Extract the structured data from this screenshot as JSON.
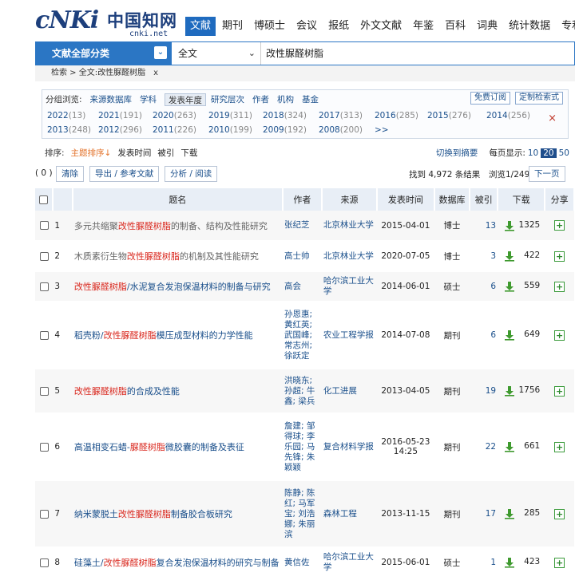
{
  "logo": {
    "brand": "cNKi",
    "cn_name": "中国知网",
    "url": "cnki.net"
  },
  "nav": [
    "文献",
    "期刊",
    "博硕士",
    "会议",
    "报纸",
    "外文文献",
    "年鉴",
    "百科",
    "词典",
    "统计数据",
    "专利"
  ],
  "search": {
    "category": "文献全部分类",
    "field": "全文",
    "query": "改性脲醛树脂"
  },
  "breadcrumb": {
    "text": "检索 > 全文:改性脲醛树脂",
    "close": "x"
  },
  "group": {
    "label": "分组浏览:",
    "tabs": [
      "来源数据库",
      "学科",
      "发表年度",
      "研究层次",
      "作者",
      "机构",
      "基金"
    ],
    "active_tab": "发表年度",
    "btn_subscribe": "免费订阅",
    "btn_custom": "定制检索式",
    "close": "×",
    "years": [
      {
        "y": "2022",
        "n": "(13)"
      },
      {
        "y": "2021",
        "n": "(191)"
      },
      {
        "y": "2020",
        "n": "(263)"
      },
      {
        "y": "2019",
        "n": "(311)"
      },
      {
        "y": "2018",
        "n": "(324)"
      },
      {
        "y": "2017",
        "n": "(313)"
      },
      {
        "y": "2016",
        "n": "(285)"
      },
      {
        "y": "2015",
        "n": "(276)"
      },
      {
        "y": "2014",
        "n": "(256)"
      },
      {
        "y": "2013",
        "n": "(248)"
      },
      {
        "y": "2012",
        "n": "(296)"
      },
      {
        "y": "2011",
        "n": "(226)"
      },
      {
        "y": "2010",
        "n": "(199)"
      },
      {
        "y": "2009",
        "n": "(192)"
      },
      {
        "y": "2008",
        "n": "(200)"
      },
      {
        "y": ">>",
        "n": ""
      }
    ]
  },
  "sort": {
    "label": "排序:",
    "options": [
      "主题排序↓",
      "发表时间",
      "被引",
      "下载"
    ],
    "switch": "切换到摘要",
    "per_page_label": "每页显示:",
    "per_page": [
      "10",
      "20",
      "50"
    ],
    "per_page_active": "20"
  },
  "actions": {
    "selected": "( 0 )",
    "clear": "清除",
    "export": "导出 / 参考文献",
    "analyze": "分析 / 阅读",
    "found": "找到 4,972 条结果",
    "pages": "浏览1/249",
    "next": "下一页"
  },
  "columns": [
    "",
    "题名",
    "作者",
    "来源",
    "发表时间",
    "数据库",
    "被引",
    "下载",
    "分享"
  ],
  "rows": [
    {
      "no": "1",
      "t1": "多元共缩聚",
      "hl": "改性脲醛树脂",
      "t2": "的制备、结构及性能研究",
      "authors": "张纪芝",
      "source": "北京林业大学",
      "date": "2015-04-01",
      "db": "博士",
      "cite": "13",
      "dl": "1325"
    },
    {
      "no": "2",
      "t1": "木质素衍生物",
      "hl": "改性脲醛树脂",
      "t2": "的机制及其性能研究",
      "authors": "高士帅",
      "source": "北京林业大学",
      "date": "2020-07-05",
      "db": "博士",
      "cite": "3",
      "dl": "422"
    },
    {
      "no": "3",
      "t1": "",
      "hl": "改性脲醛树脂",
      "t2": "/水泥复合发泡保温材料的制备与研究",
      "authors": "高会",
      "source": "哈尔滨工业大学",
      "date": "2014-06-01",
      "db": "硕士",
      "cite": "6",
      "dl": "559"
    },
    {
      "no": "4",
      "t1": "稻壳粉/",
      "hl": "改性脲醛树脂",
      "t2": "模压成型材料的力学性能",
      "authors": "孙恩惠; 黄红英; 武国峰; 常志州; 徐跃定",
      "source": "农业工程学报",
      "date": "2014-07-08",
      "db": "期刊",
      "cite": "6",
      "dl": "649"
    },
    {
      "no": "5",
      "t1": "",
      "hl": "改性脲醛树脂",
      "t2": "的合成及性能",
      "authors": "洪晓东; 孙超; 牛鑫; 梁兵",
      "source": "化工进展",
      "date": "2013-04-05",
      "db": "期刊",
      "cite": "19",
      "dl": "1756"
    },
    {
      "no": "6",
      "t1": "高温相变石蜡-",
      "hl": "脲醛树脂",
      "t2": "微胶囊的制备及表征",
      "authors": "詹建; 邹得球; 李乐园; 马先锋; 朱颖颖",
      "source": "复合材料学报",
      "date": "2016-05-23 14:25",
      "db": "期刊",
      "cite": "22",
      "dl": "661"
    },
    {
      "no": "7",
      "t1": "纳米蒙脱土",
      "hl": "改性脲醛树脂",
      "t2": "制备胶合板研究",
      "authors": "陈静; 陈红; 马军宝; 刘浩娜; 朱丽滨",
      "source": "森林工程",
      "date": "2013-11-15",
      "db": "期刊",
      "cite": "17",
      "dl": "285"
    },
    {
      "no": "8",
      "t1": "硅藻土/",
      "hl": "改性脲醛树脂",
      "t2": "复合发泡保温材料的研究与制备",
      "authors": "黄信佐",
      "source": "哈尔滨工业大学",
      "date": "2015-06-01",
      "db": "硕士",
      "cite": "1",
      "dl": "423"
    }
  ]
}
